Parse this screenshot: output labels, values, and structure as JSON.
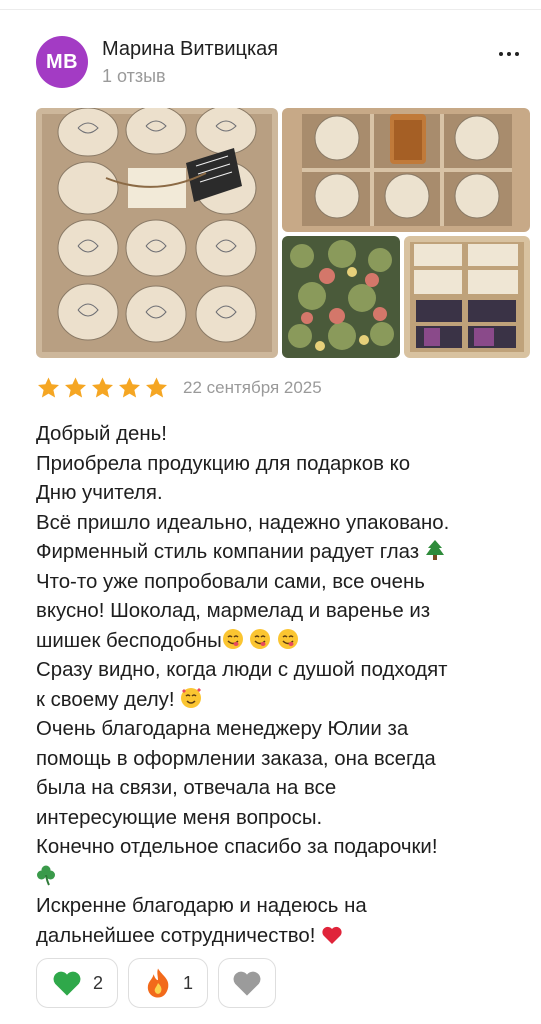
{
  "review": {
    "author": {
      "initials": "МВ",
      "name": "Марина Витвицкая",
      "reviews_count": "1 отзыв",
      "avatar_color": "#a33bc4"
    },
    "rating": 5,
    "date": "22 сентября 2025",
    "lines": [
      "Добрый день!",
      "Приобрела продукцию для подарков ко",
      "Дню учителя.",
      "Всё пришло идеально, надежно упаковано.",
      "Фирменный стиль компании радует глаз",
      "Что-то уже попробовали сами, все очень",
      "вкусно! Шоколад, мармелад и варенье из",
      "шишек бесподобны",
      "Сразу видно, когда люди с душой подходят",
      "к своему делу!",
      "Очень благодарна менеджеру Юлии за",
      "помощь в оформлении заказа, она всегда",
      "была на связи, отвечала на все",
      "интересующие меня вопросы.",
      "Конечно отдельное спасибо за подарочки!",
      "",
      "Искренне благодарю и надеюсь на",
      "дальнейшее сотрудничество!"
    ],
    "reactions": [
      {
        "icon": "green-heart-icon",
        "count": "2"
      },
      {
        "icon": "fire-icon",
        "count": "1"
      },
      {
        "icon": "grey-heart-icon",
        "count": ""
      }
    ]
  },
  "colors": {
    "star": "#f5a623",
    "meta_text": "#9a9a9a",
    "accent_avatar": "#a33bc4"
  }
}
